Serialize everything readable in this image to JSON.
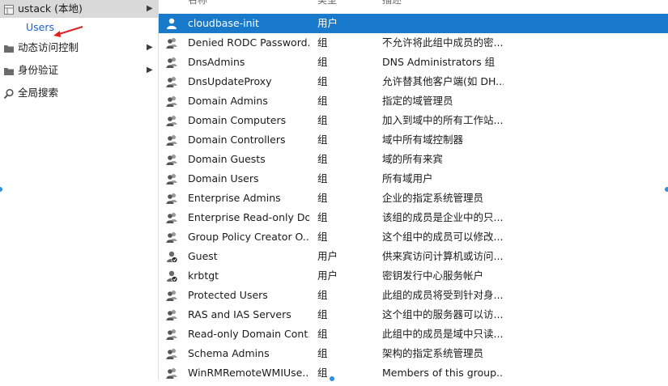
{
  "tree": {
    "items": [
      {
        "label": "ustack (本地)",
        "icon": "server-icon",
        "has_arrow": true
      },
      {
        "label": "Users",
        "icon": "",
        "has_arrow": false
      },
      {
        "label": "动态访问控制",
        "icon": "folder-icon",
        "has_arrow": true
      },
      {
        "label": "身份验证",
        "icon": "folder-icon",
        "has_arrow": true
      },
      {
        "label": "全局搜索",
        "icon": "search-icon",
        "has_arrow": false
      }
    ]
  },
  "columns": {
    "name": "名称",
    "type": "类型",
    "description": "描述"
  },
  "rows": [
    {
      "name": "cloudbase-init",
      "type": "用户",
      "desc": "",
      "kind": "user",
      "selected": true
    },
    {
      "name": "Denied RODC Password...",
      "type": "组",
      "desc": "不允许将此组中成员的密...",
      "kind": "group"
    },
    {
      "name": "DnsAdmins",
      "type": "组",
      "desc": "DNS Administrators 组",
      "kind": "group"
    },
    {
      "name": "DnsUpdateProxy",
      "type": "组",
      "desc": "允许替其他客户端(如 DH...",
      "kind": "group"
    },
    {
      "name": "Domain Admins",
      "type": "组",
      "desc": "指定的域管理员",
      "kind": "group"
    },
    {
      "name": "Domain Computers",
      "type": "组",
      "desc": "加入到域中的所有工作站...",
      "kind": "group"
    },
    {
      "name": "Domain Controllers",
      "type": "组",
      "desc": "域中所有域控制器",
      "kind": "group"
    },
    {
      "name": "Domain Guests",
      "type": "组",
      "desc": "域的所有来宾",
      "kind": "group"
    },
    {
      "name": "Domain Users",
      "type": "组",
      "desc": "所有域用户",
      "kind": "group"
    },
    {
      "name": "Enterprise Admins",
      "type": "组",
      "desc": "企业的指定系统管理员",
      "kind": "group"
    },
    {
      "name": "Enterprise Read-only Do...",
      "type": "组",
      "desc": "该组的成员是企业中的只...",
      "kind": "group"
    },
    {
      "name": "Group Policy Creator O...",
      "type": "组",
      "desc": "这个组中的成员可以修改...",
      "kind": "group"
    },
    {
      "name": "Guest",
      "type": "用户",
      "desc": "供来宾访问计算机或访问...",
      "kind": "user-disabled"
    },
    {
      "name": "krbtgt",
      "type": "用户",
      "desc": "密钥发行中心服务帐户",
      "kind": "user-disabled"
    },
    {
      "name": "Protected Users",
      "type": "组",
      "desc": "此组的成员将受到针对身...",
      "kind": "group"
    },
    {
      "name": "RAS and IAS Servers",
      "type": "组",
      "desc": "这个组中的服务器可以访...",
      "kind": "group"
    },
    {
      "name": "Read-only Domain Cont...",
      "type": "组",
      "desc": "此组中的成员是域中只读...",
      "kind": "group"
    },
    {
      "name": "Schema Admins",
      "type": "组",
      "desc": "架构的指定系统管理员",
      "kind": "group"
    },
    {
      "name": "WinRMRemoteWMIUse...",
      "type": "组",
      "desc": "Members of this group...",
      "kind": "group"
    }
  ],
  "colors": {
    "selection": "#1979ca",
    "tree_selected": "#d9d9d9",
    "link_blue": "#1a5fd1",
    "annotation_red": "#e02020"
  }
}
